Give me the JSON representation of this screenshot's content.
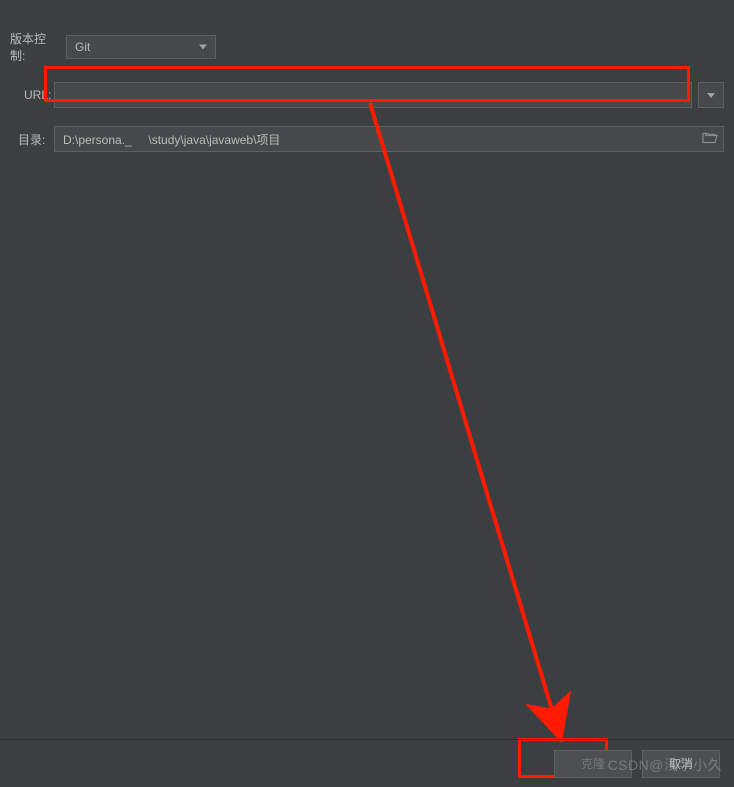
{
  "labels": {
    "vcs": "版本控制:",
    "url": "URL:",
    "dir": "目录:"
  },
  "vcs": {
    "selected": "Git"
  },
  "url": {
    "value": ""
  },
  "directory": {
    "value": "D:\\persona._     \\study\\java\\javaweb\\项目"
  },
  "buttons": {
    "clone": "克隆",
    "cancel": "取消"
  },
  "watermark": "CSDN@浅学小久"
}
